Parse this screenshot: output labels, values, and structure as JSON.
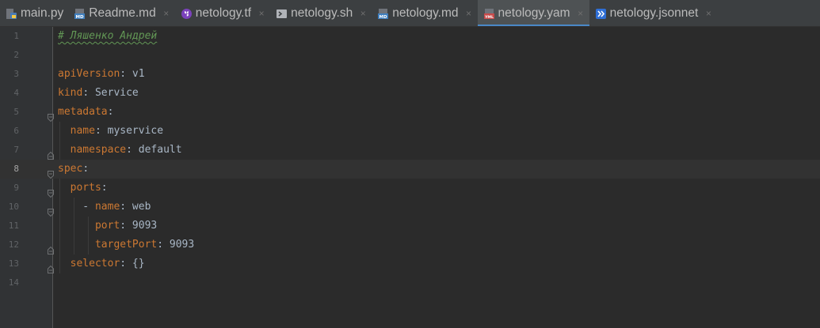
{
  "tabs": [
    {
      "label": "main.py",
      "icon": "python-file-icon",
      "active": false,
      "closable": false
    },
    {
      "label": "Readme.md",
      "icon": "markdown-file-icon",
      "active": false,
      "closable": true
    },
    {
      "label": "netology.tf",
      "icon": "terraform-file-icon",
      "active": false,
      "closable": true
    },
    {
      "label": "netology.sh",
      "icon": "shell-file-icon",
      "active": false,
      "closable": true
    },
    {
      "label": "netology.md",
      "icon": "markdown-file-icon",
      "active": false,
      "closable": true
    },
    {
      "label": "netology.yam",
      "icon": "yaml-file-icon",
      "active": true,
      "closable": true
    },
    {
      "label": "netology.jsonnet",
      "icon": "jsonnet-file-icon",
      "active": false,
      "closable": true
    }
  ],
  "close_glyph": "×",
  "editor": {
    "current_line": 8,
    "lines": [
      {
        "num": "1",
        "tokens": [
          {
            "t": "c",
            "s": "# Ляшенко Андрей"
          }
        ]
      },
      {
        "num": "2",
        "tokens": []
      },
      {
        "num": "3",
        "tokens": [
          {
            "t": "k",
            "s": "apiVersion"
          },
          {
            "t": "v",
            "s": ": v1"
          }
        ]
      },
      {
        "num": "4",
        "tokens": [
          {
            "t": "k",
            "s": "kind"
          },
          {
            "t": "v",
            "s": ": Service"
          }
        ]
      },
      {
        "num": "5",
        "tokens": [
          {
            "t": "k",
            "s": "metadata"
          },
          {
            "t": "v",
            "s": ":"
          }
        ]
      },
      {
        "num": "6",
        "tokens": [
          {
            "t": "v",
            "s": "  "
          },
          {
            "t": "k",
            "s": "name"
          },
          {
            "t": "v",
            "s": ": myservice"
          }
        ]
      },
      {
        "num": "7",
        "tokens": [
          {
            "t": "v",
            "s": "  "
          },
          {
            "t": "k",
            "s": "namespace"
          },
          {
            "t": "v",
            "s": ": default"
          }
        ]
      },
      {
        "num": "8",
        "tokens": [
          {
            "t": "k",
            "s": "spec"
          },
          {
            "t": "v",
            "s": ":"
          }
        ]
      },
      {
        "num": "9",
        "tokens": [
          {
            "t": "v",
            "s": "  "
          },
          {
            "t": "k",
            "s": "ports"
          },
          {
            "t": "v",
            "s": ":"
          }
        ]
      },
      {
        "num": "10",
        "tokens": [
          {
            "t": "v",
            "s": "    - "
          },
          {
            "t": "k",
            "s": "name"
          },
          {
            "t": "v",
            "s": ": web"
          }
        ]
      },
      {
        "num": "11",
        "tokens": [
          {
            "t": "v",
            "s": "      "
          },
          {
            "t": "k",
            "s": "port"
          },
          {
            "t": "v",
            "s": ": 9093"
          }
        ]
      },
      {
        "num": "12",
        "tokens": [
          {
            "t": "v",
            "s": "      "
          },
          {
            "t": "k",
            "s": "targetPort"
          },
          {
            "t": "v",
            "s": ": 9093"
          }
        ]
      },
      {
        "num": "13",
        "tokens": [
          {
            "t": "v",
            "s": "  "
          },
          {
            "t": "k",
            "s": "selector"
          },
          {
            "t": "v",
            "s": ": {}"
          }
        ]
      },
      {
        "num": "14",
        "tokens": []
      }
    ]
  },
  "colors": {
    "key": "#cc7832",
    "value": "#a9b7c6",
    "comment": "#629755",
    "accent": "#4a88c7"
  }
}
